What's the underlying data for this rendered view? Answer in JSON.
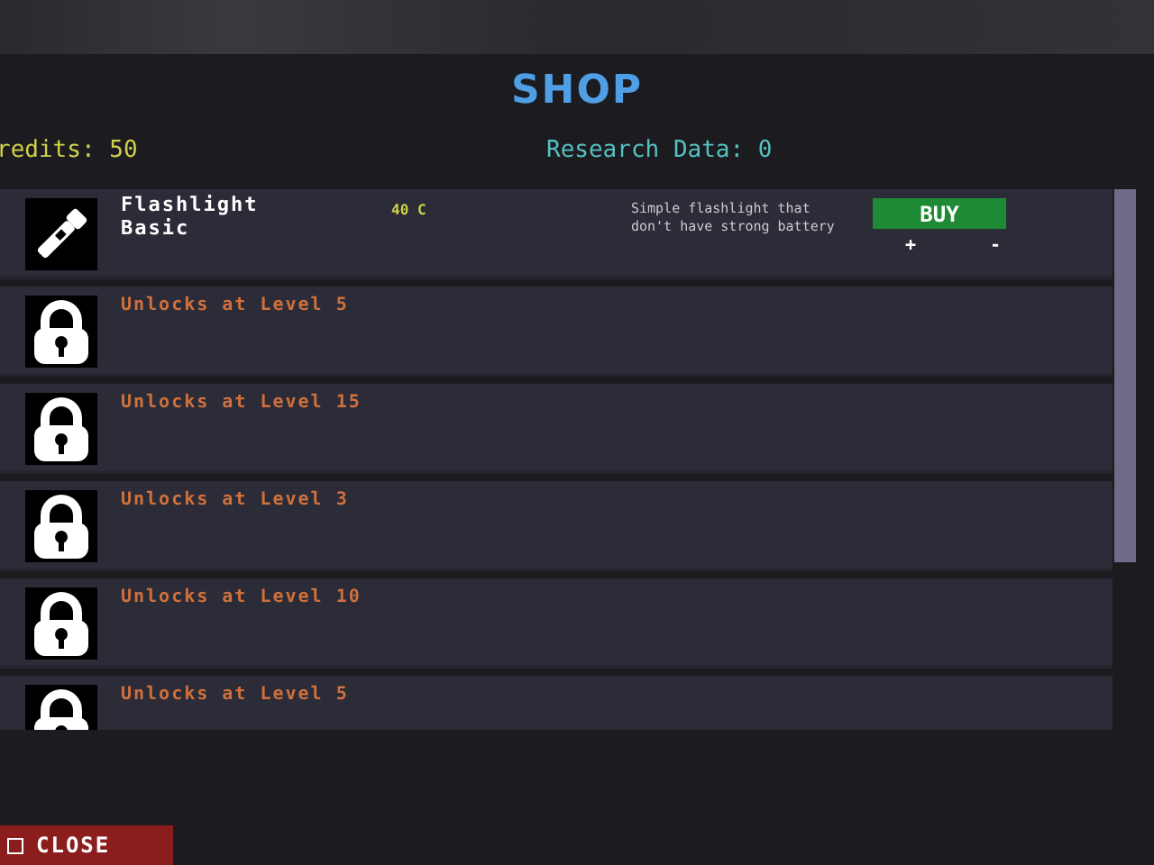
{
  "title": "SHOP",
  "credits": "redits: 50",
  "research": "Research Data: 0",
  "items": [
    {
      "kind": "item",
      "name": "Flashlight\nBasic",
      "price": "40 C",
      "description": "Simple flashlight that\ndon't have strong battery",
      "buy": "BUY",
      "plus": "+",
      "minus": "-"
    },
    {
      "kind": "locked",
      "label": "Unlocks at Level 5"
    },
    {
      "kind": "locked",
      "label": "Unlocks at Level 15"
    },
    {
      "kind": "locked",
      "label": "Unlocks at Level 3"
    },
    {
      "kind": "locked",
      "label": "Unlocks at Level 10"
    },
    {
      "kind": "locked",
      "label": "Unlocks at Level 5"
    }
  ],
  "close": "CLOSE"
}
